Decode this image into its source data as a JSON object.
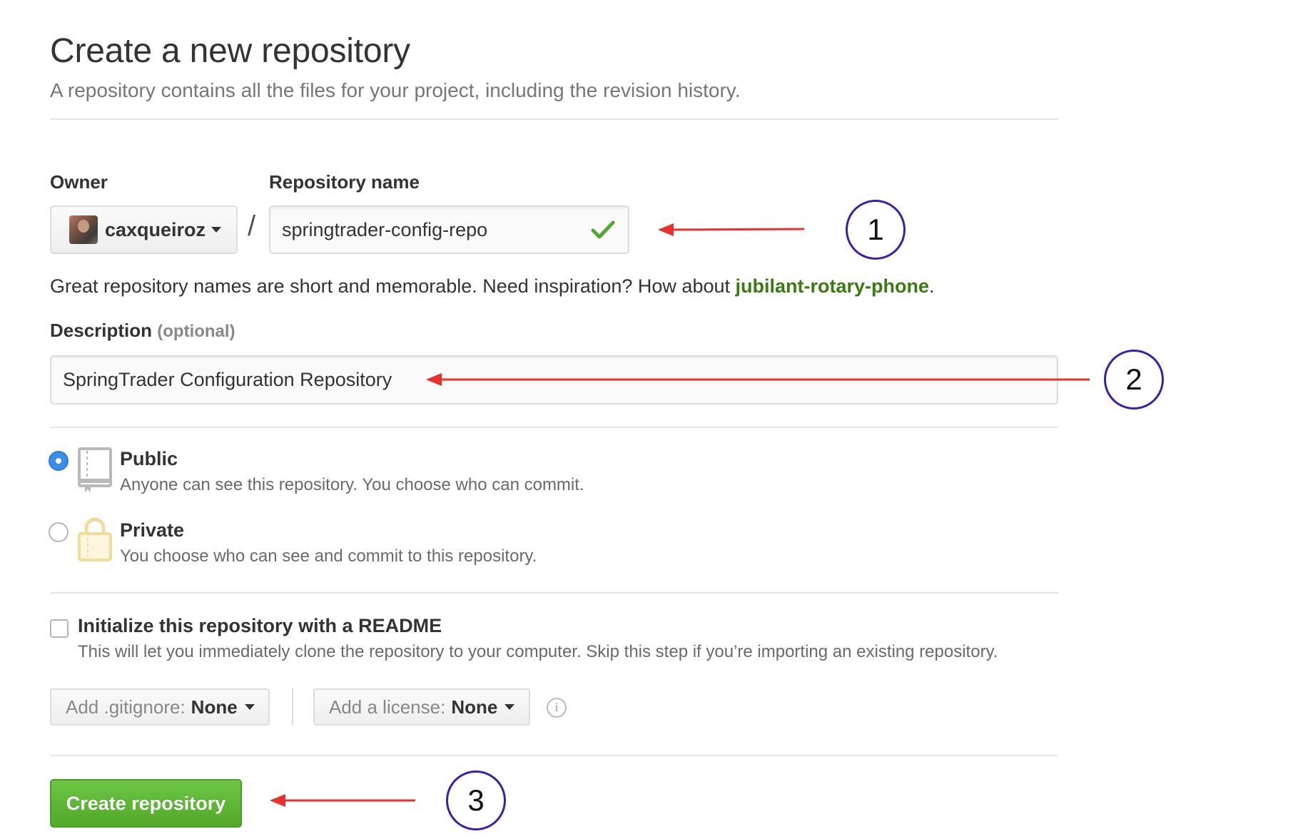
{
  "page": {
    "title": "Create a new repository",
    "subtitle": "A repository contains all the files for your project, including the revision history."
  },
  "owner": {
    "label": "Owner",
    "value": "caxqueiroz",
    "separator": "/"
  },
  "repo_name": {
    "label": "Repository name",
    "value": "springtrader-config-repo",
    "status_icon": "check-icon",
    "status_color": "#55a532"
  },
  "hint": {
    "text": "Great repository names are short and memorable. Need inspiration? How about ",
    "suggestion": "jubilant-rotary-phone",
    "suffix": "."
  },
  "description": {
    "label": "Description",
    "optional_label": "(optional)",
    "value": "SpringTrader Configuration Repository"
  },
  "visibility": {
    "selected": "public",
    "options": [
      {
        "id": "public",
        "title": "Public",
        "description": "Anyone can see this repository. You choose who can commit.",
        "icon": "repo-book-icon"
      },
      {
        "id": "private",
        "title": "Private",
        "description": "You choose who can see and commit to this repository.",
        "icon": "lock-icon"
      }
    ]
  },
  "readme": {
    "checked": false,
    "title": "Initialize this repository with a README",
    "description": "This will let you immediately clone the repository to your computer. Skip this step if you’re importing an existing repository."
  },
  "gitignore": {
    "label": "Add .gitignore:",
    "value": "None"
  },
  "license": {
    "label": "Add a license:",
    "value": "None",
    "info_icon": "info-icon"
  },
  "submit": {
    "label": "Create repository",
    "color": "#6cc644"
  },
  "annotations": [
    {
      "number": "1",
      "arrow_color": "#e8302e",
      "circle_color": "#3f1ea5"
    },
    {
      "number": "2",
      "arrow_color": "#e8302e",
      "circle_color": "#3f1ea5"
    },
    {
      "number": "3",
      "arrow_color": "#e8302e",
      "circle_color": "#3f1ea5"
    }
  ]
}
